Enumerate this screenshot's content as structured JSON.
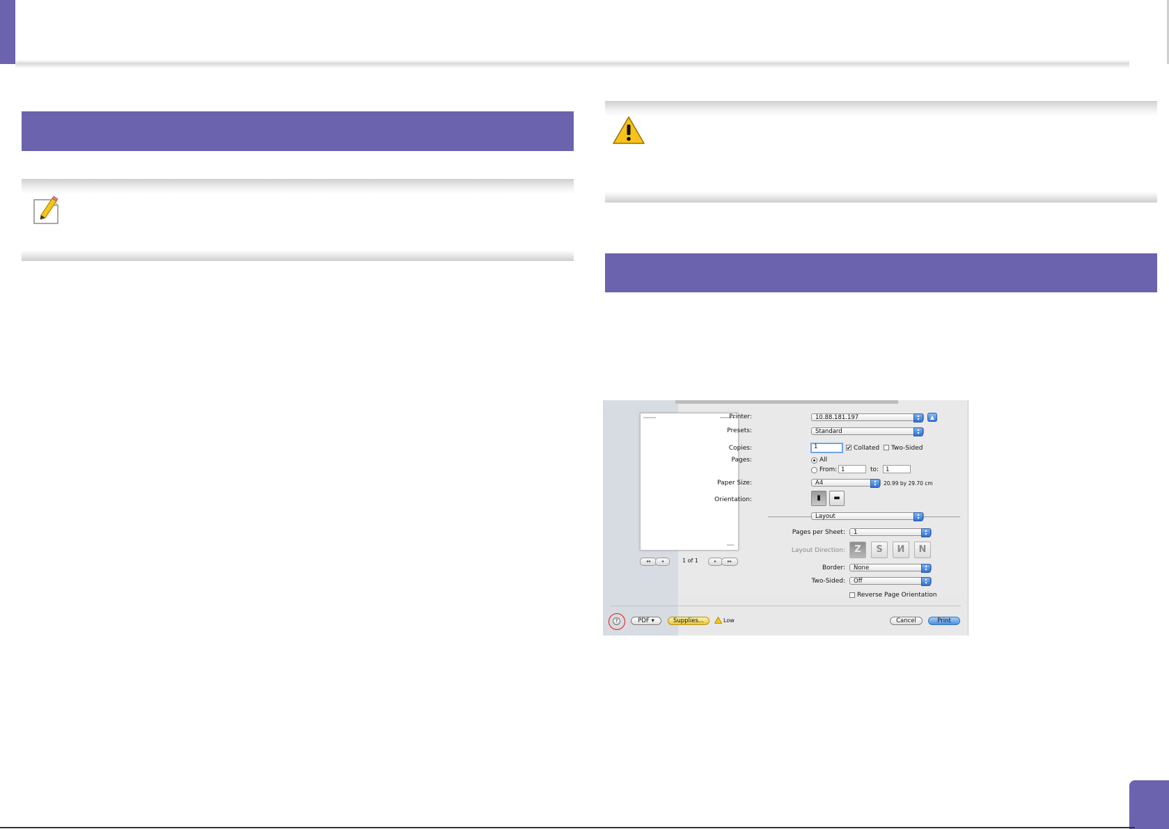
{
  "document": {
    "page_badge_number": ""
  },
  "print_dialog": {
    "preview": {
      "page_indicator": "1 of 1",
      "nav_first": "◂◂",
      "nav_prev": "◂",
      "nav_next": "▸",
      "nav_last": "▸▸"
    },
    "printer": {
      "label": "Printer:",
      "value": "10.88.181.197"
    },
    "presets": {
      "label": "Presets:",
      "value": "Standard"
    },
    "copies": {
      "label": "Copies:",
      "value": "1",
      "collated_label": "Collated",
      "collated_checked": true,
      "two_sided_label": "Two-Sided",
      "two_sided_checked": false
    },
    "pages": {
      "label": "Pages:",
      "all_label": "All",
      "from_label": "From:",
      "from_value": "1",
      "to_label": "to:",
      "to_value": "1"
    },
    "paper_size": {
      "label": "Paper Size:",
      "value": "A4",
      "dimensions": "20.99 by 29.70 cm"
    },
    "orientation": {
      "label": "Orientation:"
    },
    "panel_select": {
      "value": "Layout"
    },
    "pages_per_sheet": {
      "label": "Pages per Sheet:",
      "value": "1"
    },
    "layout_direction": {
      "label": "Layout Direction:"
    },
    "border": {
      "label": "Border:",
      "value": "None"
    },
    "two_sided": {
      "label": "Two-Sided:",
      "value": "Off"
    },
    "reverse_orientation": {
      "label": "Reverse Page Orientation",
      "checked": false
    },
    "footer": {
      "help": "?",
      "pdf": "PDF ▾",
      "supplies": "Supplies...",
      "supply_status": "Low",
      "cancel": "Cancel",
      "print": "Print"
    }
  },
  "colors": {
    "accent": "#6b63ad",
    "highlight_ring": "#e01818"
  }
}
